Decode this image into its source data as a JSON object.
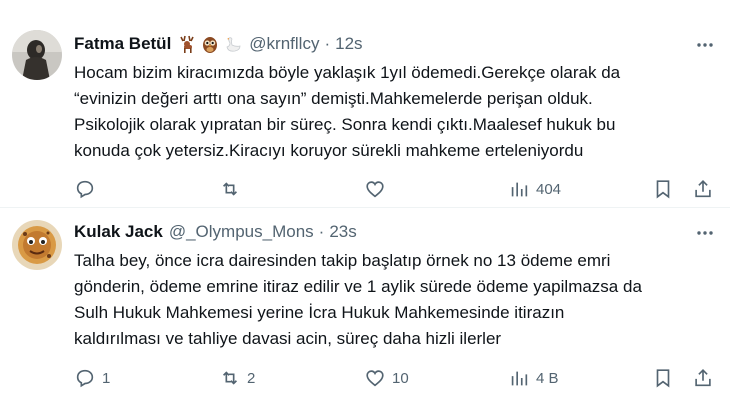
{
  "tweets": [
    {
      "name": "Fatma Betül",
      "emojis": [
        "deer-emoji",
        "owl-emoji",
        "swan-emoji"
      ],
      "handle": "@krnfllcy",
      "dot": "·",
      "time": "12s",
      "lines": [
        "Hocam bizim kiracımızda böyle yaklaşık 1yıl ödemedi.Gerekçe olarak da",
        "“evinizin değeri arttı ona sayın” demişti.Mahkemelerde perişan olduk.",
        "Psikolojik olarak yıpratan bir süreç. Sonra kendi çıktı.Maalesef hukuk bu",
        "konuda çok yetersiz.Kiracıyı koruyor sürekli mahkeme erteleniyordu"
      ],
      "actions": {
        "replies": "",
        "reposts": "",
        "likes": "",
        "views": "404"
      }
    },
    {
      "name": "Kulak Jack",
      "emojis": [],
      "handle": "@_Olympus_Mons",
      "dot": "·",
      "time": "23s",
      "lines": [
        "Talha bey, önce icra dairesinden takip başlatıp örnek no 13 ödeme emri",
        "gönderin, ödeme emrine itiraz edilir ve 1 aylik sürede ödeme yapilmazsa da",
        "Sulh Hukuk Mahkemesi yerine İcra Hukuk Mahkemesinde itirazın",
        "kaldırılması ve tahliye davasi acin, süreç daha hizli ilerler"
      ],
      "actions": {
        "replies": "1",
        "reposts": "2",
        "likes": "10",
        "views": "4 B"
      }
    }
  ],
  "colors": {
    "text": "#0f1419",
    "secondary": "#536471",
    "divider": "#eff3f4"
  }
}
